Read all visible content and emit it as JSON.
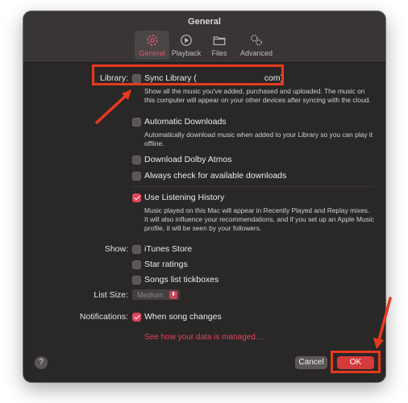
{
  "window": {
    "title": "General"
  },
  "tabs": [
    {
      "label": "General",
      "icon": "gear-icon",
      "active": true
    },
    {
      "label": "Playback",
      "icon": "play-icon",
      "active": false
    },
    {
      "label": "Files",
      "icon": "folder-icon",
      "active": false
    },
    {
      "label": "Advanced",
      "icon": "gears-icon",
      "active": false
    }
  ],
  "library": {
    "label": "Library:",
    "sync_label": "Sync Library (",
    "sync_label_end": "com)",
    "sync_checked": false,
    "sync_desc": "Show all the music you've added, purchased and uploaded. The music on this computer will appear on your other devices after syncing with the cloud.",
    "auto_downloads": "Automatic Downloads",
    "auto_downloads_checked": false,
    "auto_downloads_desc": "Automatically download music when added to your Library so you can play it offline.",
    "dolby": "Download Dolby Atmos",
    "dolby_checked": false,
    "always_check": "Always check for available downloads",
    "always_check_checked": false,
    "listening_history": "Use Listening History",
    "listening_history_checked": true,
    "listening_history_desc": "Music played on this Mac will appear in Recently Played and Replay mixes. It will also influence your recommendations, and if you set up an Apple Music profile, it will be seen by your followers."
  },
  "show": {
    "label": "Show:",
    "itunes_store": "iTunes Store",
    "star_ratings": "Star ratings",
    "songs_tickboxes": "Songs list tickboxes"
  },
  "list_size": {
    "label": "List Size:",
    "value": "Medium"
  },
  "notifications": {
    "label": "Notifications:",
    "when_song_changes": "When song changes",
    "checked": true
  },
  "privacy_link": "See how your data is managed…",
  "footer": {
    "help": "?",
    "cancel": "Cancel",
    "ok": "OK"
  },
  "colors": {
    "accent": "#e0455a",
    "annotation": "#e63a1f",
    "window_bg": "#2a2727"
  }
}
